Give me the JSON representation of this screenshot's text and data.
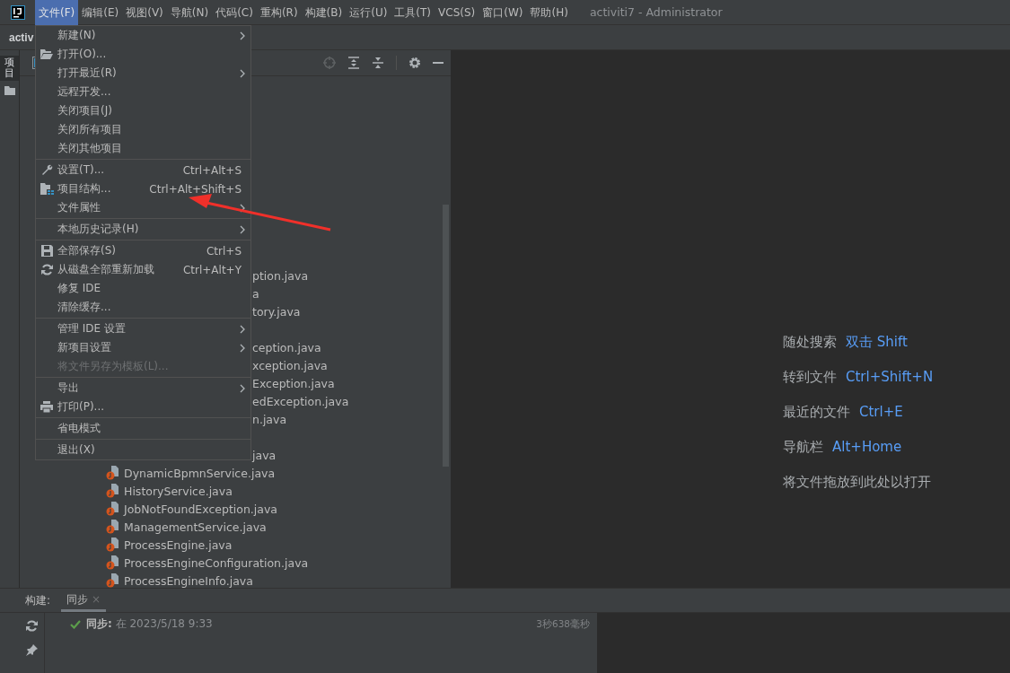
{
  "menubar": {
    "items": [
      {
        "label": "文件(F)",
        "selected": true
      },
      {
        "label": "编辑(E)",
        "selected": false
      },
      {
        "label": "视图(V)",
        "selected": false
      },
      {
        "label": "导航(N)",
        "selected": false
      },
      {
        "label": "代码(C)",
        "selected": false
      },
      {
        "label": "重构(R)",
        "selected": false
      },
      {
        "label": "构建(B)",
        "selected": false
      },
      {
        "label": "运行(U)",
        "selected": false
      },
      {
        "label": "工具(T)",
        "selected": false
      },
      {
        "label": "VCS(S)",
        "selected": false
      },
      {
        "label": "窗口(W)",
        "selected": false
      },
      {
        "label": "帮助(H)",
        "selected": false
      }
    ],
    "title": "activiti7 - Administrator"
  },
  "toolbar": {
    "project_name": "activ"
  },
  "left_strip": {
    "tab": "项目"
  },
  "file_menu": {
    "groups": [
      {
        "items": [
          {
            "label": "新建(N)",
            "submenu": true,
            "disabled": false
          },
          {
            "label": "打开(O)...",
            "submenu": false,
            "disabled": false
          },
          {
            "label": "打开最近(R)",
            "submenu": true,
            "disabled": false
          },
          {
            "label": "远程开发...",
            "submenu": false,
            "disabled": false
          },
          {
            "label": "关闭项目(J)",
            "submenu": false,
            "disabled": false
          },
          {
            "label": "关闭所有项目",
            "submenu": false,
            "disabled": false
          },
          {
            "label": "关闭其他项目",
            "submenu": false,
            "disabled": false
          }
        ]
      },
      {
        "items": [
          {
            "label": "设置(T)...",
            "shortcut": "Ctrl+Alt+S",
            "submenu": false,
            "disabled": false
          },
          {
            "label": "项目结构...",
            "shortcut": "Ctrl+Alt+Shift+S",
            "submenu": false,
            "disabled": false
          },
          {
            "label": "文件属性",
            "submenu": true,
            "disabled": false
          }
        ]
      },
      {
        "items": [
          {
            "label": "本地历史记录(H)",
            "submenu": true,
            "disabled": false
          }
        ]
      },
      {
        "items": [
          {
            "label": "全部保存(S)",
            "shortcut": "Ctrl+S",
            "submenu": false,
            "disabled": false
          },
          {
            "label": "从磁盘全部重新加载",
            "shortcut": "Ctrl+Alt+Y",
            "submenu": false,
            "disabled": false
          },
          {
            "label": "修复 IDE",
            "submenu": false,
            "disabled": false
          },
          {
            "label": "清除缓存...",
            "submenu": false,
            "disabled": false
          }
        ]
      },
      {
        "items": [
          {
            "label": "管理 IDE 设置",
            "submenu": true,
            "disabled": false
          },
          {
            "label": "新项目设置",
            "submenu": true,
            "disabled": false
          },
          {
            "label": "将文件另存为模板(L)...",
            "submenu": false,
            "disabled": true
          }
        ]
      },
      {
        "items": [
          {
            "label": "导出",
            "submenu": true,
            "disabled": false
          },
          {
            "label": "打印(P)...",
            "submenu": false,
            "disabled": false
          }
        ]
      },
      {
        "items": [
          {
            "label": "省电模式",
            "submenu": false,
            "disabled": false
          }
        ]
      },
      {
        "items": [
          {
            "label": "退出(X)",
            "submenu": false,
            "disabled": false
          }
        ]
      }
    ]
  },
  "tree": {
    "rows": [
      {
        "kind": "covered",
        "text": "ption.java"
      },
      {
        "kind": "covered",
        "text": "a"
      },
      {
        "kind": "covered",
        "text": "tory.java"
      },
      {
        "kind": "covered",
        "text": "ception.java",
        "gap_before": true
      },
      {
        "kind": "covered",
        "text": "xception.java"
      },
      {
        "kind": "covered",
        "text": "Exception.java"
      },
      {
        "kind": "covered",
        "text": "edException.java"
      },
      {
        "kind": "covered",
        "text": "n.java"
      },
      {
        "kind": "covered",
        "text": "java",
        "gap_before": true
      },
      {
        "kind": "file",
        "text": "DynamicBpmnService.java"
      },
      {
        "kind": "file",
        "text": "HistoryService.java"
      },
      {
        "kind": "file",
        "text": "JobNotFoundException.java"
      },
      {
        "kind": "file",
        "text": "ManagementService.java"
      },
      {
        "kind": "file",
        "text": "ProcessEngine.java"
      },
      {
        "kind": "file",
        "text": "ProcessEngineConfiguration.java"
      },
      {
        "kind": "file",
        "text": "ProcessEngineInfo.java"
      }
    ]
  },
  "editor_hints": [
    {
      "label": "随处搜索",
      "shortcut": "双击 Shift"
    },
    {
      "label": "转到文件",
      "shortcut": "Ctrl+Shift+N"
    },
    {
      "label": "最近的文件",
      "shortcut": "Ctrl+E"
    },
    {
      "label": "导航栏",
      "shortcut": "Alt+Home"
    },
    {
      "label": "将文件拖放到此处以打开"
    }
  ],
  "build_panel": {
    "label": "构建:",
    "tabs": [
      {
        "label": "同步",
        "selected": true,
        "close": "×"
      }
    ],
    "rows": [
      {
        "text": "**同步:** 在 2023/5/18 9:33",
        "duration": "3秒638毫秒"
      }
    ]
  }
}
